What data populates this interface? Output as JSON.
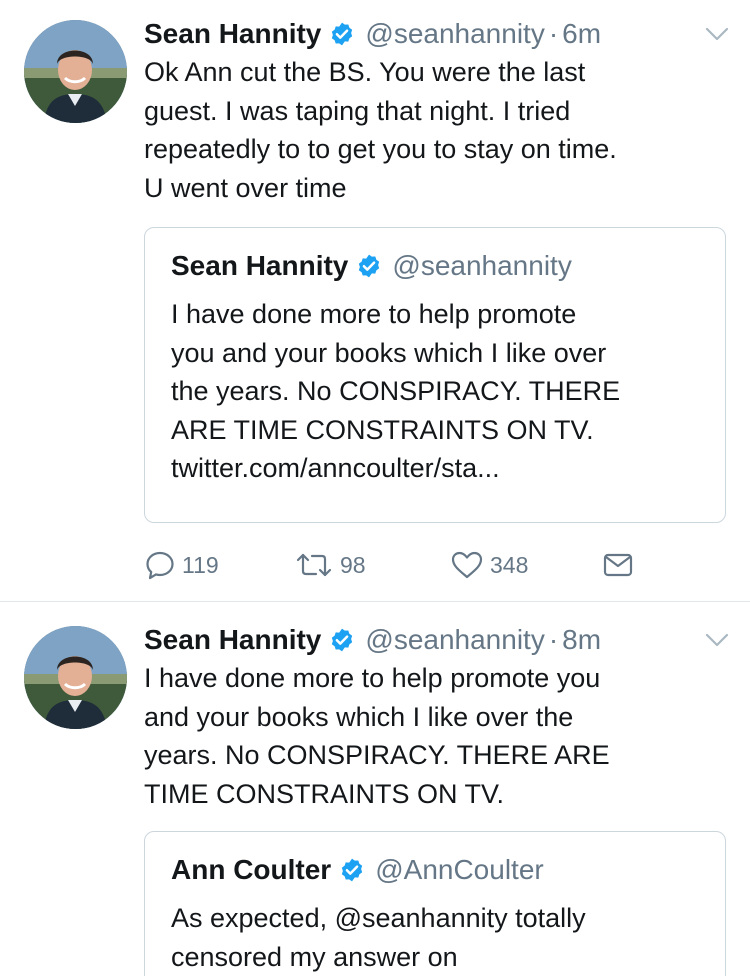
{
  "tweets": [
    {
      "name": "Sean Hannity",
      "handle": "@seanhannity",
      "dot": "·",
      "time": "6m",
      "text_lines": [
        "Ok Ann cut the BS. You were the last",
        "guest. I was taping that night. I tried",
        "repeatedly to to get you to stay on time.",
        "U went over time"
      ],
      "quote": {
        "name": "Sean Hannity",
        "handle": "@seanhannity",
        "text_lines": [
          "I have done more to help promote",
          "you and your books which I like over",
          "the years. No CONSPIRACY. THERE",
          "ARE TIME CONSTRAINTS ON TV.",
          "twitter.com/anncoulter/sta..."
        ]
      },
      "actions": {
        "replies": "119",
        "retweets": "98",
        "likes": "348"
      }
    },
    {
      "name": "Sean Hannity",
      "handle": "@seanhannity",
      "dot": "·",
      "time": "8m",
      "text_lines": [
        "I have done more to help promote you",
        "and your books which I like over the",
        "years. No CONSPIRACY. THERE ARE",
        "TIME CONSTRAINTS ON TV."
      ],
      "quote": {
        "name": "Ann Coulter",
        "handle": "@AnnCoulter",
        "text_lines": [
          "As expected, @seanhannity totally",
          "censored my answer on"
        ]
      }
    }
  ],
  "icons": {
    "verified": "verified-badge-icon",
    "chevron": "chevron-down-icon",
    "reply": "reply-icon",
    "retweet": "retweet-icon",
    "like": "heart-icon",
    "dm": "envelope-icon"
  },
  "colors": {
    "verified_blue": "#1da1f2",
    "text": "#14171a",
    "secondary": "#657786",
    "border": "#ccd6dd"
  }
}
